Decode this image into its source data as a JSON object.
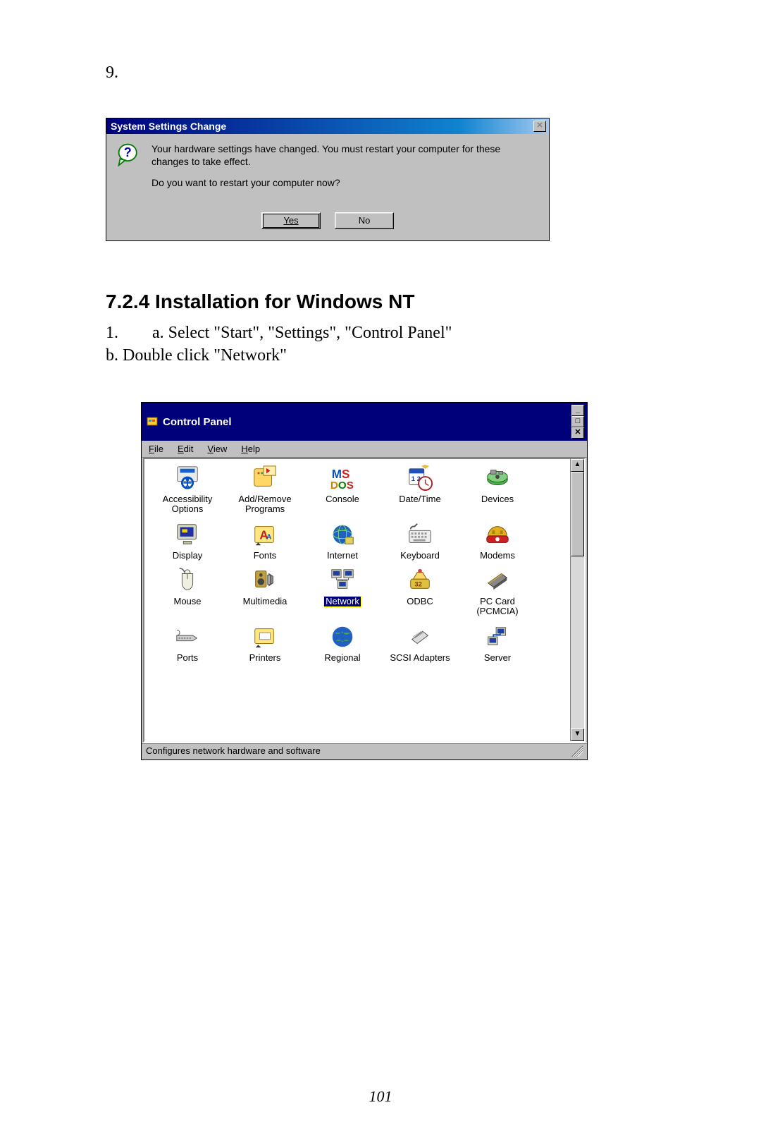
{
  "step_number": "9.",
  "dialog": {
    "title": "System Settings Change",
    "line1": "Your hardware settings have changed. You must restart your computer for these changes to take effect.",
    "line2": "Do you want to restart your computer now?",
    "yes": "Yes",
    "no": "No"
  },
  "section": {
    "heading": "7.2.4 Installation for Windows NT",
    "step_num": "1.",
    "step_a": "a. Select \"Start\", \"Settings\", \"Control Panel\"",
    "step_b": "b. Double click \"Network\""
  },
  "cp": {
    "title": "Control Panel",
    "menu": {
      "file": "File",
      "edit": "Edit",
      "view": "View",
      "help": "Help"
    },
    "items": {
      "r0": [
        "Accessibility Options",
        "Add/Remove Programs",
        "Console",
        "Date/Time",
        "Devices"
      ],
      "r1": [
        "Display",
        "Fonts",
        "Internet",
        "Keyboard",
        "Modems"
      ],
      "r2": [
        "Mouse",
        "Multimedia",
        "Network",
        "ODBC",
        "PC Card (PCMCIA)"
      ],
      "r3": [
        "Ports",
        "Printers",
        "Regional",
        "SCSI Adapters",
        "Server"
      ]
    },
    "status": "Configures network hardware and software"
  },
  "page_number": "101"
}
